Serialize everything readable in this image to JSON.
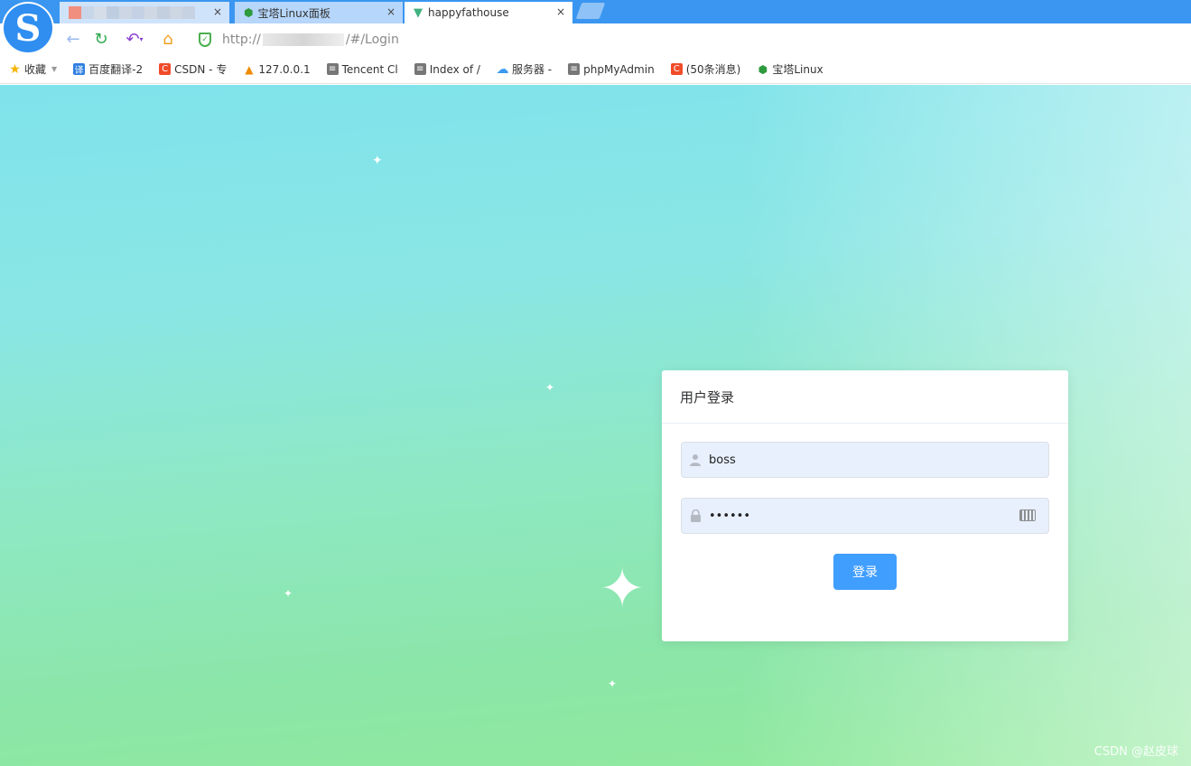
{
  "browser": {
    "tabs": [
      {
        "label": "",
        "close": "×"
      },
      {
        "label": "宝塔Linux面板",
        "close": "×"
      },
      {
        "label": "happyfathouse",
        "close": "×"
      }
    ],
    "url": {
      "prefix": "http://",
      "suffix": "/#/Login"
    },
    "bookmarks": [
      {
        "label": "收藏",
        "icon": "star-icon"
      },
      {
        "label": "百度翻译-2",
        "icon": "translate-icon"
      },
      {
        "label": "CSDN - 专",
        "icon": "csdn-icon"
      },
      {
        "label": "127.0.0.1",
        "icon": "phpmyadmin-icon"
      },
      {
        "label": "Tencent Cl",
        "icon": "doc-icon"
      },
      {
        "label": "Index of /",
        "icon": "doc-icon"
      },
      {
        "label": "服务器 -",
        "icon": "cloud-icon"
      },
      {
        "label": "phpMyAdmin",
        "icon": "doc-icon"
      },
      {
        "label": "(50条消息)",
        "icon": "csdn-icon"
      },
      {
        "label": "宝塔Linux",
        "icon": "shield-icon"
      }
    ]
  },
  "login": {
    "title": "用户登录",
    "username": "boss",
    "password": "••••••",
    "submit_label": "登录"
  },
  "watermark": "CSDN @赵皮球",
  "colors": {
    "primary": "#409eff",
    "tabbar": "#3a96f0"
  }
}
